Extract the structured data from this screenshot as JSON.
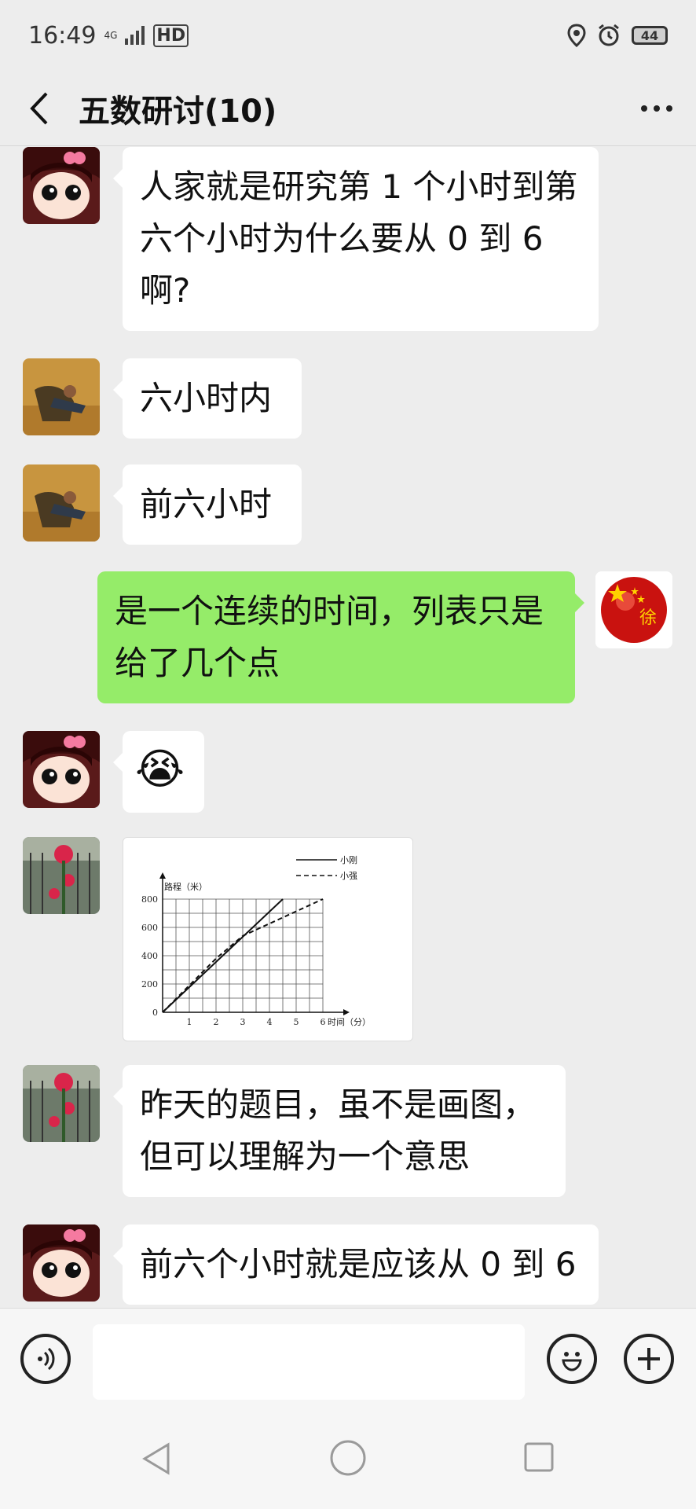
{
  "status": {
    "time": "16:49",
    "network": "4G",
    "hd": "HD",
    "battery": "44"
  },
  "header": {
    "title": "五数研讨(10)"
  },
  "messages": [
    {
      "side": "left",
      "text": "人家就是研究第 1 个小时到第六个小时为什么要从 0 到 6 啊?"
    },
    {
      "side": "left",
      "text": "六小时内"
    },
    {
      "side": "left",
      "text": "前六小时"
    },
    {
      "side": "right",
      "text": "是一个连续的时间，列表只是给了几个点"
    },
    {
      "side": "left",
      "emoji": "😭"
    },
    {
      "side": "left",
      "image": "line-chart"
    },
    {
      "side": "left",
      "text": "昨天的题目，虽不是画图，但可以理解为一个意思"
    },
    {
      "side": "left",
      "text": "前六个小时就是应该从 0 到 6"
    }
  ],
  "chart_data": {
    "type": "line",
    "title": "",
    "ylabel": "路程（米）",
    "xlabel": "时间（分）",
    "x": [
      0,
      1,
      2,
      3,
      4,
      5,
      6
    ],
    "xticks": [
      "1",
      "2",
      "3",
      "4",
      "5",
      "6"
    ],
    "yticks": [
      "0",
      "200",
      "400",
      "600",
      "800"
    ],
    "ylim": [
      0,
      800
    ],
    "xlim": [
      0,
      6
    ],
    "grid": true,
    "legend_position": "top-right",
    "series": [
      {
        "name": "小刚",
        "style": "solid",
        "points": [
          [
            0,
            0
          ],
          [
            4.5,
            800
          ]
        ]
      },
      {
        "name": "小强",
        "style": "dashed",
        "points": [
          [
            0,
            0
          ],
          [
            2,
            380
          ],
          [
            3,
            540
          ],
          [
            6,
            800
          ]
        ]
      }
    ]
  },
  "input": {
    "value": "",
    "placeholder": ""
  },
  "colors": {
    "background": "#ededed",
    "self_bubble": "#95ec69",
    "other_bubble": "#ffffff"
  }
}
